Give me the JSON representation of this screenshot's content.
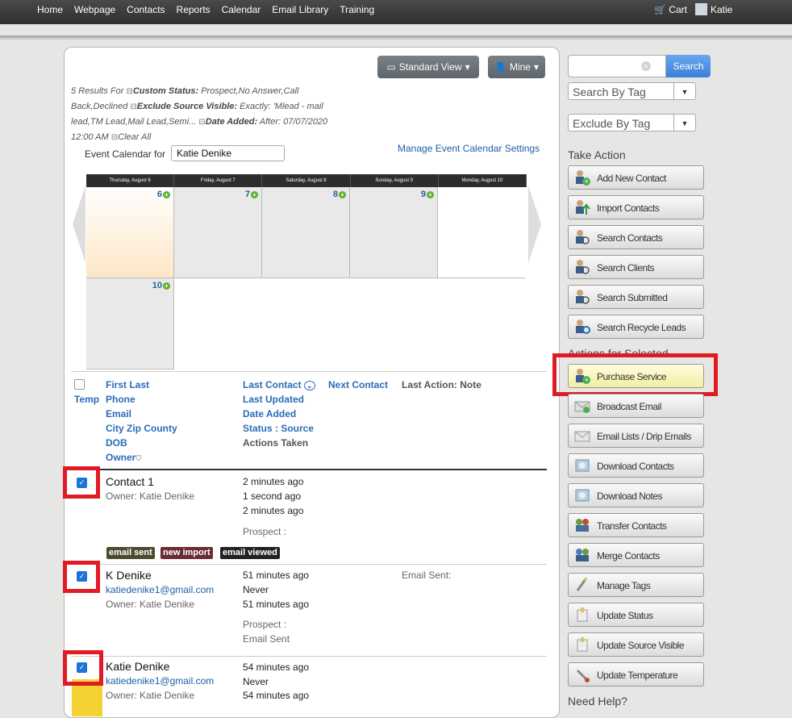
{
  "nav": {
    "items": [
      "Home",
      "Webpage",
      "Contacts",
      "Reports",
      "Calendar",
      "Email Library",
      "Training"
    ],
    "cart": "Cart",
    "user": "Katie"
  },
  "toolbar": {
    "view": "Standard View",
    "owner": "Mine"
  },
  "filters": {
    "line1": "5 Results For ",
    "f1_label": "Custom Status:",
    "f1_value": " Prospect,No Answer,Call Back,Declined ",
    "f2_label": "Exclude Source Visible:",
    "f2_value": " Exactly: 'Mlead - mail lead,TM Lead,Mail Lead,Semi... ",
    "f3_label": "Date Added:",
    "f3_value": " After: 07/07/2020 12:00 AM ",
    "clear": "Clear All"
  },
  "calendar": {
    "label": "Event Calendar for",
    "value": "Katie Denike",
    "manage": "Manage Event Calendar Settings",
    "days": [
      "Thursday, August 6",
      "Friday, August 7",
      "Saturday, August 8",
      "Sunday, August 9",
      "Monday, August 10"
    ],
    "nums": [
      "6",
      "7",
      "8",
      "9",
      "10"
    ]
  },
  "columns": {
    "temp": "Temp",
    "c1": [
      "First Last",
      "Phone",
      "Email",
      "City Zip County",
      "DOB",
      "Owner"
    ],
    "c2": [
      "Last Contact",
      "Last Updated",
      "Date Added",
      "Status : Source",
      "Actions Taken"
    ],
    "c3": "Next Contact",
    "c4": "Last Action: Note"
  },
  "rows": [
    {
      "name": "Contact 1",
      "owner": "Owner: Katie Denike",
      "lc": "2 minutes ago",
      "lu": "1 second ago",
      "da": "2 minutes ago",
      "status": "Prospect :",
      "tags": [
        "email sent",
        "new import",
        "email viewed"
      ]
    },
    {
      "name": "K Denike",
      "email": "katiedenike1@gmail.com",
      "owner": "Owner: Katie Denike",
      "lc": "51 minutes ago",
      "lu": "Never",
      "da": "51 minutes ago",
      "status": "Prospect :",
      "action": "Email Sent",
      "note": "Email Sent:"
    },
    {
      "name": "Katie Denike",
      "email": "katiedenike1@gmail.com",
      "owner": "Owner: Katie Denike",
      "lc": "54 minutes ago",
      "lu": "Never",
      "da": "54 minutes ago"
    }
  ],
  "sidebar": {
    "search_btn": "Search",
    "search_tag": "Search By Tag",
    "exclude_tag": "Exclude By Tag",
    "take_action": "Take Action",
    "actions_selected": "Actions for Selected",
    "need_help": "Need Help?",
    "take": [
      "Add New Contact",
      "Import Contacts",
      "Search Contacts",
      "Search Clients",
      "Search Submitted",
      "Search Recycle Leads"
    ],
    "selected": [
      "Purchase Service",
      "Broadcast Email",
      "Email Lists / Drip Emails",
      "Download Contacts",
      "Download Notes",
      "Transfer Contacts",
      "Merge Contacts",
      "Manage Tags",
      "Update Status",
      "Update Source Visible",
      "Update Temperature"
    ]
  },
  "colors": {
    "accent": "#3b7fd8",
    "highlight": "#e01b24",
    "tag_sent": "#4e4a2f",
    "tag_import": "#6b2b35",
    "tag_viewed": "#222222"
  }
}
